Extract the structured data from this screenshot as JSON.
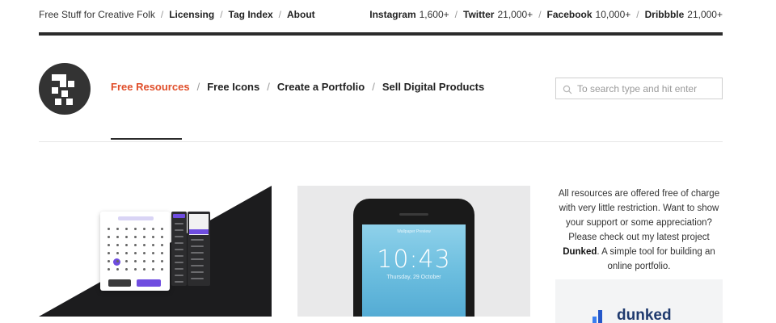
{
  "topbar": {
    "tagline": "Free Stuff for Creative Folk",
    "links": [
      "Licensing",
      "Tag Index",
      "About"
    ],
    "social": [
      {
        "name": "Instagram",
        "count": "1,600+"
      },
      {
        "name": "Twitter",
        "count": "21,000+"
      },
      {
        "name": "Facebook",
        "count": "10,000+"
      },
      {
        "name": "Dribbble",
        "count": "21,000+"
      }
    ]
  },
  "nav": {
    "items": [
      "Free Resources",
      "Free Icons",
      "Create a Portfolio",
      "Sell Digital Products"
    ],
    "active_index": 0
  },
  "search": {
    "placeholder": "To search type and hit enter",
    "icon": "search-icon"
  },
  "thumbnails": [
    {
      "subject": "date picker UI kit preview",
      "colors": {
        "accent": "#6f4de0"
      }
    },
    {
      "subject": "iPhone lock screen mockup",
      "time": "10:43",
      "date": "Thursday, 29 October",
      "caption": "Wallpaper Preview"
    }
  ],
  "sidebar": {
    "text_before": "All resources are offered free of charge with very little restriction. Want to show your support or some appreciation? Please check out my latest project ",
    "project": "Dunked",
    "text_after": ". A simple tool for building an online portfolio.",
    "promo_word": "dunked"
  },
  "colors": {
    "accent": "#e04e2a",
    "dark": "#2b2b2b"
  }
}
